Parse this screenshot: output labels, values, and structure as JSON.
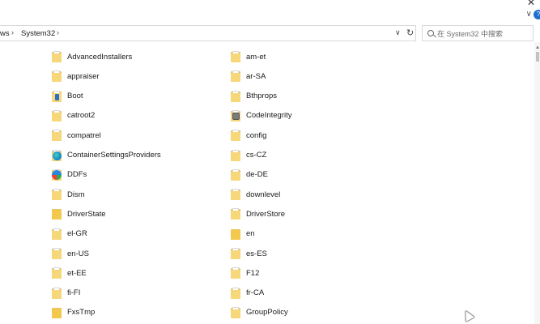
{
  "window": {
    "close_glyph": "✕",
    "chevron_glyph": "∨",
    "help_glyph": "?"
  },
  "address": {
    "crumbs": [
      "ws",
      "System32"
    ],
    "sep": "›",
    "dropdown_glyph": "∨",
    "refresh_glyph": "↻"
  },
  "search": {
    "placeholder": "在 System32 中搜索"
  },
  "items": [
    {
      "name": "AdvancedInstallers",
      "icon": "folder-icon",
      "col": 0,
      "row": 0
    },
    {
      "name": "appraiser",
      "icon": "folder-icon",
      "col": 0,
      "row": 1
    },
    {
      "name": "Boot",
      "icon": "folder-boot-icon",
      "col": 0,
      "row": 2
    },
    {
      "name": "catroot2",
      "icon": "folder-icon",
      "col": 0,
      "row": 3
    },
    {
      "name": "compatrel",
      "icon": "folder-icon",
      "col": 0,
      "row": 4
    },
    {
      "name": "ContainerSettingsProviders",
      "icon": "edge-folder-icon",
      "col": 0,
      "row": 5
    },
    {
      "name": "DDFs",
      "icon": "ddf-folder-icon",
      "col": 0,
      "row": 6
    },
    {
      "name": "Dism",
      "icon": "folder-icon",
      "col": 0,
      "row": 7
    },
    {
      "name": "DriverState",
      "icon": "folder-plain-icon",
      "col": 0,
      "row": 8
    },
    {
      "name": "el-GR",
      "icon": "folder-icon",
      "col": 0,
      "row": 9
    },
    {
      "name": "en-US",
      "icon": "folder-icon",
      "col": 0,
      "row": 10
    },
    {
      "name": "et-EE",
      "icon": "folder-icon",
      "col": 0,
      "row": 11
    },
    {
      "name": "fi-FI",
      "icon": "folder-icon",
      "col": 0,
      "row": 12
    },
    {
      "name": "FxsTmp",
      "icon": "folder-plain-icon",
      "col": 0,
      "row": 13
    },
    {
      "name": "am-et",
      "icon": "folder-icon",
      "col": 1,
      "row": 0
    },
    {
      "name": "ar-SA",
      "icon": "folder-icon",
      "col": 1,
      "row": 1
    },
    {
      "name": "Bthprops",
      "icon": "folder-icon",
      "col": 1,
      "row": 2
    },
    {
      "name": "CodeIntegrity",
      "icon": "codeintegrity-folder-icon",
      "col": 1,
      "row": 3
    },
    {
      "name": "config",
      "icon": "folder-icon",
      "col": 1,
      "row": 4
    },
    {
      "name": "cs-CZ",
      "icon": "folder-icon",
      "col": 1,
      "row": 5
    },
    {
      "name": "de-DE",
      "icon": "folder-icon",
      "col": 1,
      "row": 6
    },
    {
      "name": "downlevel",
      "icon": "folder-icon",
      "col": 1,
      "row": 7
    },
    {
      "name": "DriverStore",
      "icon": "folder-icon",
      "col": 1,
      "row": 8
    },
    {
      "name": "en",
      "icon": "folder-plain-icon",
      "col": 1,
      "row": 9
    },
    {
      "name": "es-ES",
      "icon": "folder-icon",
      "col": 1,
      "row": 10
    },
    {
      "name": "F12",
      "icon": "folder-icon",
      "col": 1,
      "row": 11
    },
    {
      "name": "fr-CA",
      "icon": "folder-icon",
      "col": 1,
      "row": 12
    },
    {
      "name": "GroupPolicy",
      "icon": "folder-icon",
      "col": 1,
      "row": 13
    }
  ]
}
